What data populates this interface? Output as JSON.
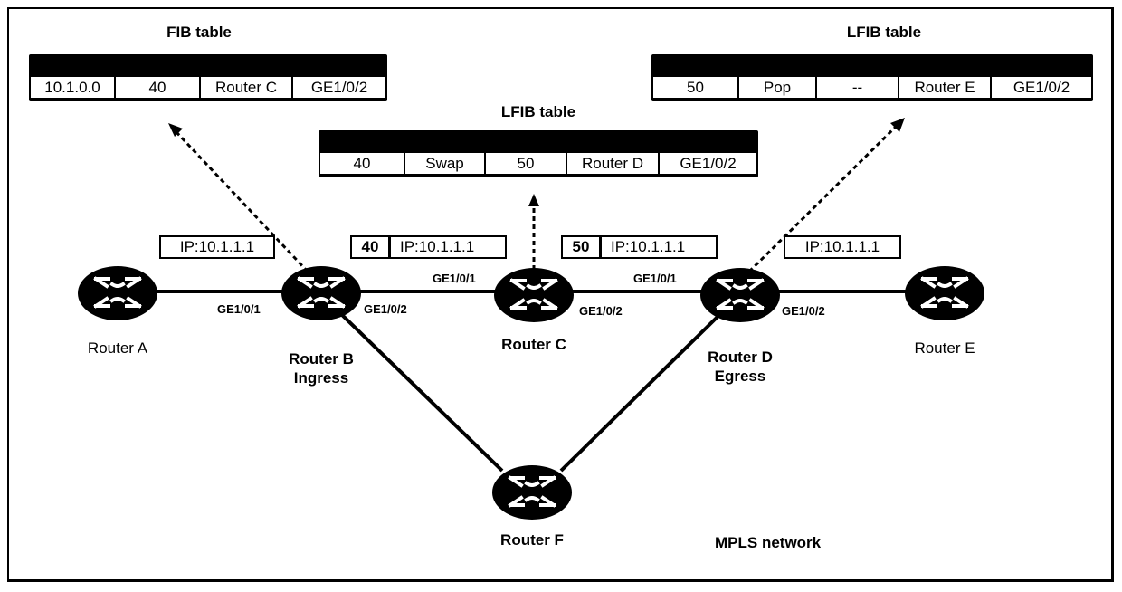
{
  "diagram": {
    "network_label": "MPLS network",
    "fib_table": {
      "title": "FIB table",
      "row": [
        "10.1.0.0",
        "40",
        "Router C",
        "GE1/0/2"
      ]
    },
    "lfib_table_c": {
      "title": "LFIB table",
      "row": [
        "40",
        "Swap",
        "50",
        "Router D",
        "GE1/0/2"
      ]
    },
    "lfib_table_d": {
      "title": "LFIB table",
      "row": [
        "50",
        "Pop",
        "--",
        "Router E",
        "GE1/0/2"
      ]
    },
    "packets": {
      "a_to_b": {
        "ip": "IP:10.1.1.1"
      },
      "b_to_c": {
        "label": "40",
        "ip": "IP:10.1.1.1"
      },
      "c_to_d": {
        "label": "50",
        "ip": "IP:10.1.1.1"
      },
      "d_to_e": {
        "ip": "IP:10.1.1.1"
      }
    },
    "routers": {
      "a": {
        "name": "Router A",
        "role": ""
      },
      "b": {
        "name": "Router B",
        "role": "Ingress"
      },
      "c": {
        "name": "Router C",
        "role": ""
      },
      "d": {
        "name": "Router D",
        "role": "Egress"
      },
      "e": {
        "name": "Router E",
        "role": ""
      },
      "f": {
        "name": "Router F",
        "role": ""
      }
    },
    "ports": {
      "b_in": "GE1/0/1",
      "b_out": "GE1/0/2",
      "c_in": "GE1/0/1",
      "c_out": "GE1/0/2",
      "d_in": "GE1/0/1",
      "d_out": "GE1/0/2"
    }
  }
}
